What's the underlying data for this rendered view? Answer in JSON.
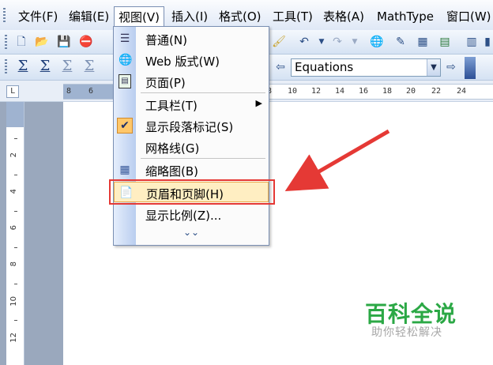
{
  "menubar": {
    "items": [
      {
        "label": "文件(F)"
      },
      {
        "label": "编辑(E)"
      },
      {
        "label": "视图(V)"
      },
      {
        "label": "插入(I)"
      },
      {
        "label": "格式(O)"
      },
      {
        "label": "工具(T)"
      },
      {
        "label": "表格(A)"
      },
      {
        "label": "MathType"
      },
      {
        "label": "窗口(W)"
      }
    ]
  },
  "toolbar": {
    "style_value": "Equations"
  },
  "ruler": {
    "h_ticks": [
      "8",
      "6",
      "8",
      "10",
      "12",
      "14",
      "16",
      "18",
      "20",
      "22",
      "24"
    ],
    "v_ticks": [
      "2",
      "4",
      "6",
      "8",
      "10",
      "12"
    ]
  },
  "view_menu": {
    "items": [
      {
        "label": "普通(N)",
        "icon": "normal-view-icon"
      },
      {
        "label": "Web 版式(W)",
        "icon": "web-layout-icon"
      },
      {
        "label": "页面(P)",
        "icon": "print-layout-icon"
      },
      {
        "label": "工具栏(T)",
        "icon": "",
        "submenu": true
      },
      {
        "label": "显示段落标记(S)",
        "icon": "checkmark-icon",
        "checked": true
      },
      {
        "label": "网格线(G)",
        "icon": ""
      },
      {
        "label": "缩略图(B)",
        "icon": "thumbnail-icon"
      },
      {
        "label": "页眉和页脚(H)",
        "icon": "header-footer-icon",
        "highlighted": true
      },
      {
        "label": "显示比例(Z)...",
        "icon": ""
      }
    ]
  },
  "watermark": {
    "title": "百科全说",
    "subtitle": "助你轻松解决"
  },
  "colors": {
    "accent_red": "#e53935",
    "highlight": "#ffeec2",
    "watermark_green": "#2ba845"
  }
}
